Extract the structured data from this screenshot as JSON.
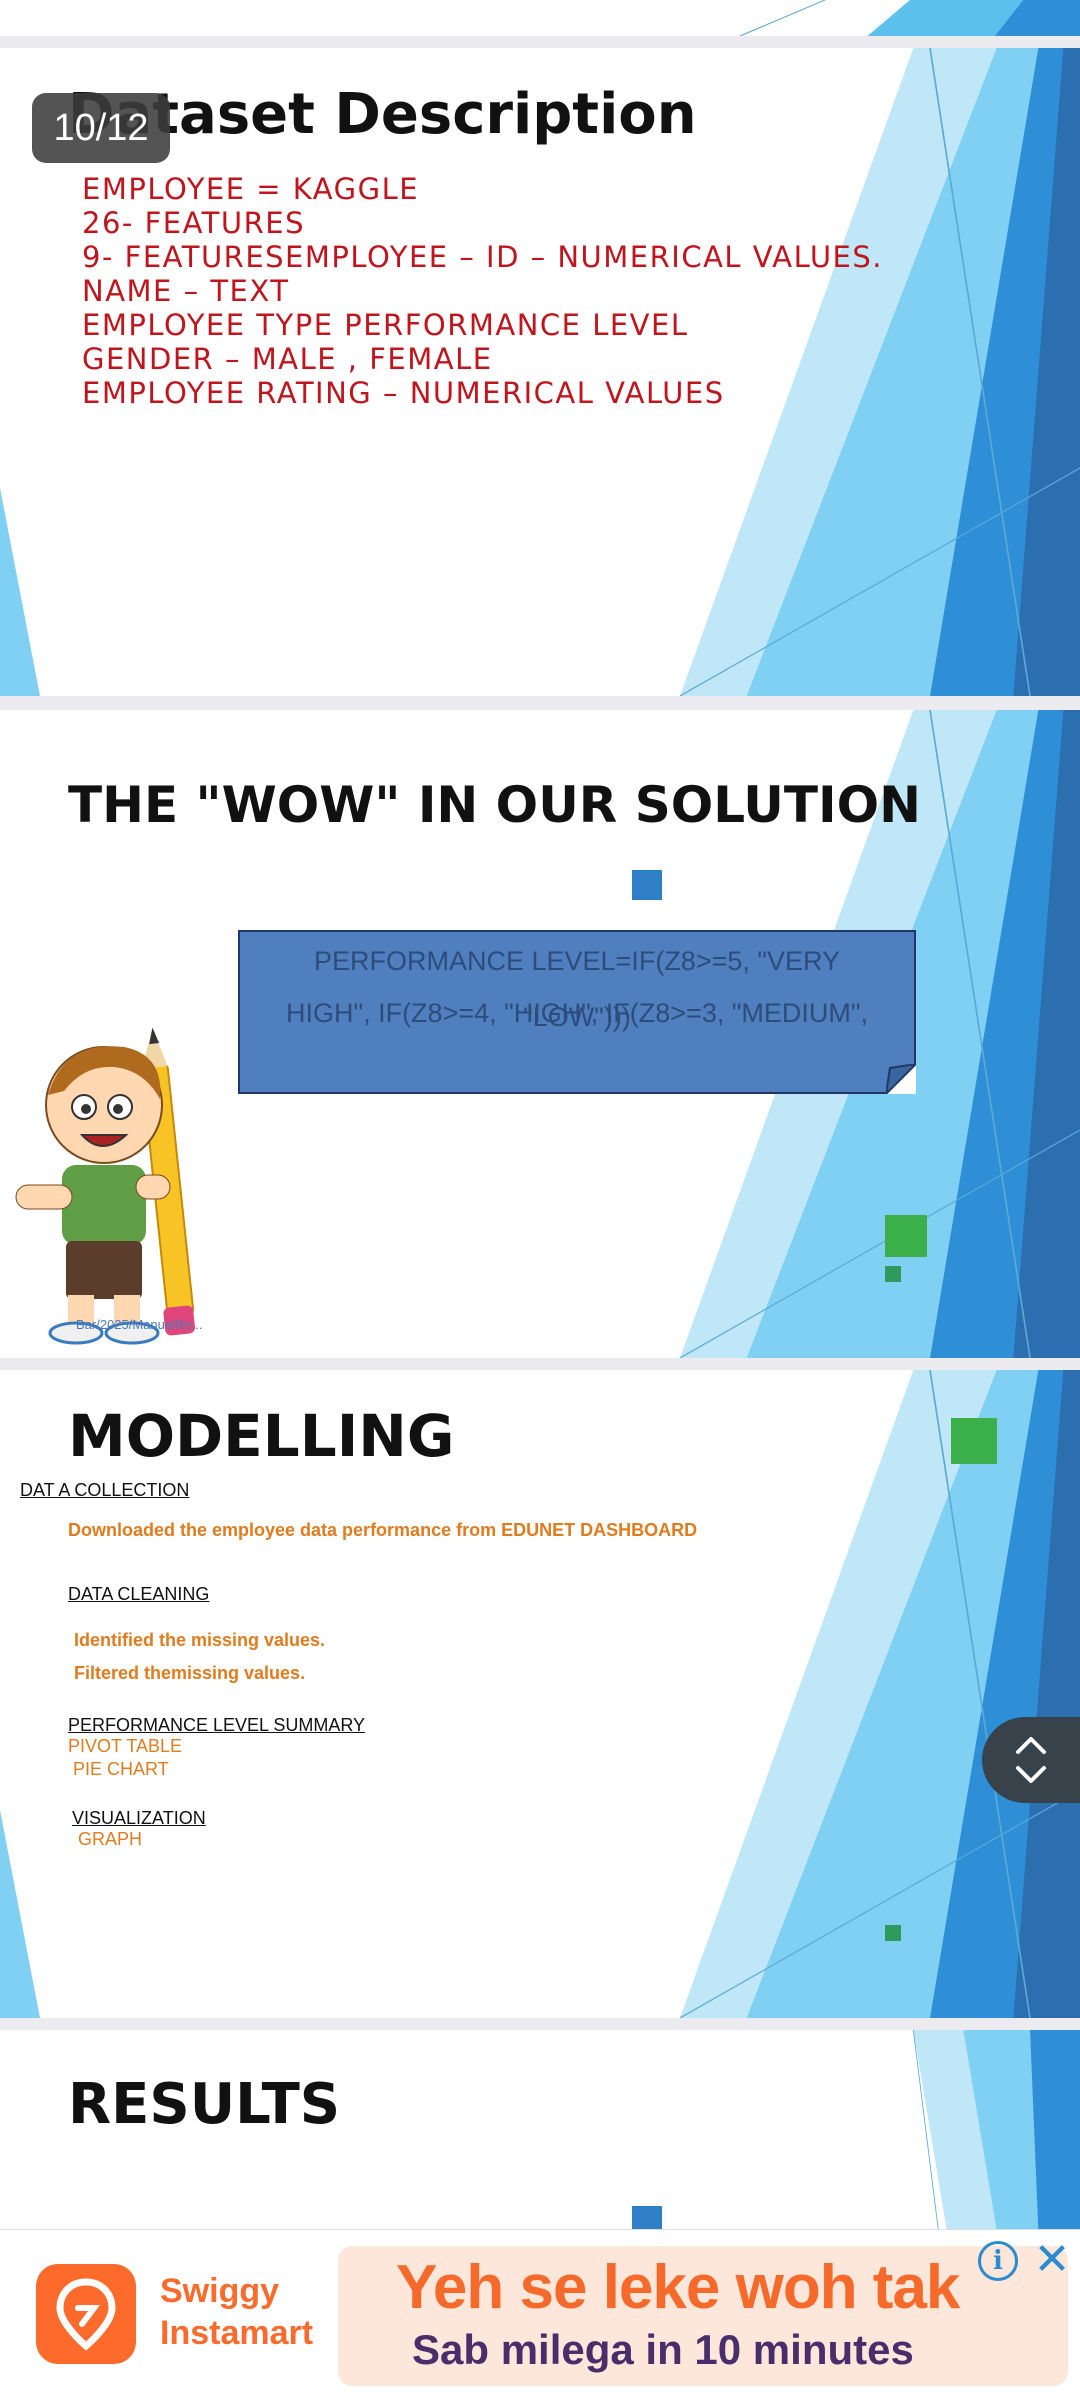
{
  "viewer": {
    "page_counter": "10/12"
  },
  "slide_dataset": {
    "title": "Dataset Description",
    "lines": [
      "EMPLOYEE = KAGGLE",
      "26- FEATURES",
      "9- FEATURESEMPLOYEE – ID – NUMERICAL VALUES.",
      "NAME – TEXT",
      "EMPLOYEE TYPE PERFORMANCE LEVEL",
      "GENDER – MALE , FEMALE",
      "EMPLOYEE RATING – NUMERICAL VALUES"
    ]
  },
  "slide_wow": {
    "title": "THE \"WOW\" IN OUR SOLUTION",
    "formula_line1": "PERFORMANCE LEVEL=IF(Z8>=5, \"VERY",
    "formula_line2": "HIGH\", IF(Z8>=4, \"HIGH\", IF(Z8>=3, \"MEDIUM\",",
    "formula_line3": "\"LOW\")))",
    "watermark": "Bar/2025/ManualRe..."
  },
  "slide_modelling": {
    "title": "MODELLING",
    "sections": {
      "data_collection": {
        "heading": "DAT A COLLECTION",
        "item": "Downloaded the employee data performance from EDUNET DASHBOARD"
      },
      "data_cleaning": {
        "heading": "DATA CLEANING",
        "item1": "Identified the missing values.",
        "item2": "Filtered themissing values."
      },
      "summary": {
        "heading": "PERFORMANCE LEVEL SUMMARY",
        "item1": "PIVOT TABLE",
        "item2": "PIE CHART"
      },
      "visualization": {
        "heading": "VISUALIZATION",
        "item1": "GRAPH"
      }
    }
  },
  "slide_results": {
    "title": "RESULTS"
  },
  "ad": {
    "brand_line1": "Swiggy",
    "brand_line2": "Instamart",
    "headline": "Yeh se leke woh tak",
    "subline": "Sab milega in 10 minutes",
    "info_symbol": "i",
    "close_symbol": "✕"
  },
  "colors": {
    "accent_blue": "#2f7fc6",
    "accent_green": "#3bb04a",
    "text_red": "#c0151d",
    "text_orange": "#e07b1e",
    "ad_orange": "#fc6a2c"
  }
}
